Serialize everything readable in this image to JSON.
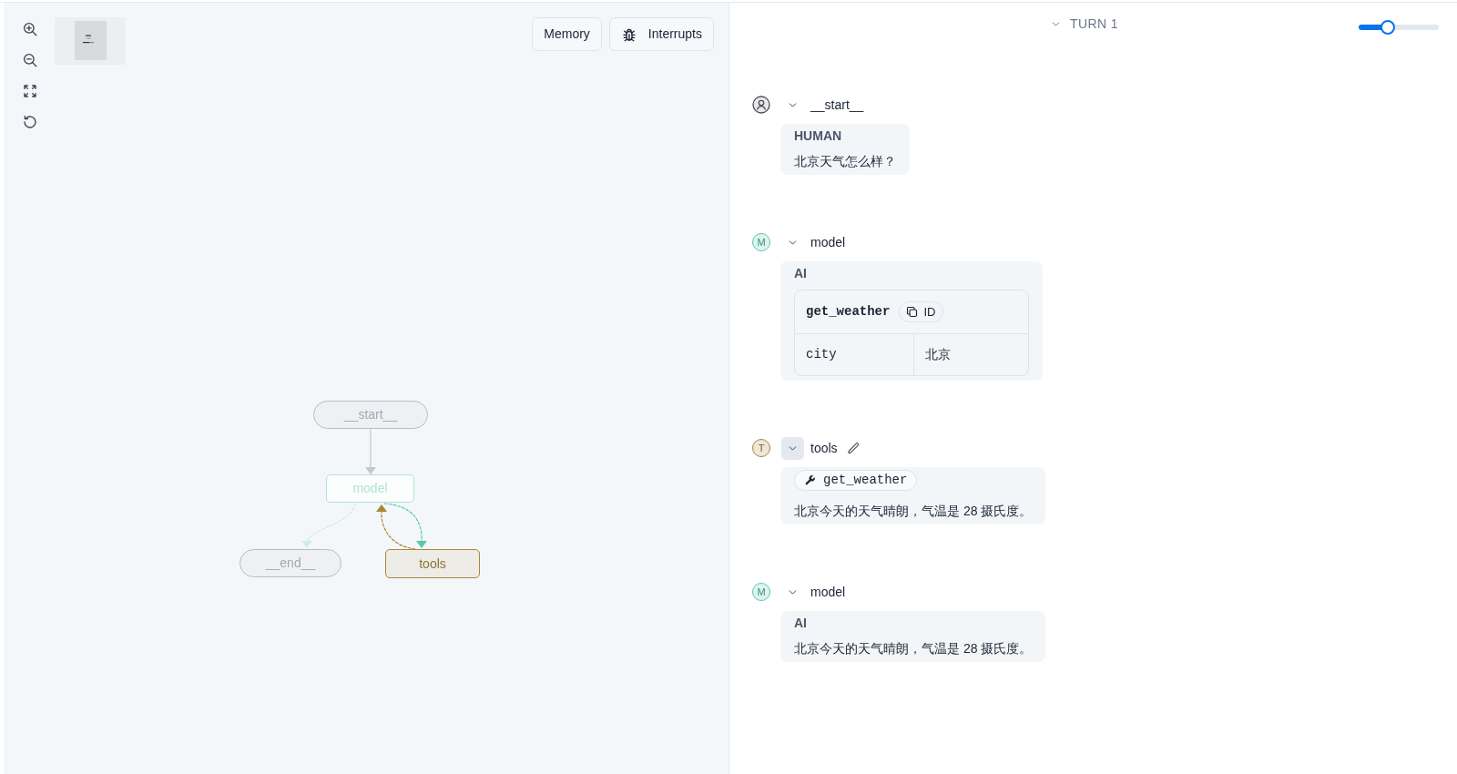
{
  "canvas": {
    "buttons": [
      {
        "label": "Memory",
        "kind": "text"
      },
      {
        "label": "Interrupts",
        "kind": "icon_text"
      }
    ],
    "graph": {
      "nodes": [
        {
          "label": "__start__",
          "kind": "terminal",
          "active": false
        },
        {
          "label": "model",
          "kind": "node",
          "color": "#b0e3d7",
          "active": false
        },
        {
          "label": "__end__",
          "kind": "terminal",
          "active": false
        },
        {
          "label": "tools",
          "kind": "node",
          "color": "#ab853a",
          "active": true
        }
      ]
    }
  },
  "run": {
    "turn": {
      "label": "TURN 1",
      "expanded": true
    },
    "slider": {
      "level": 0.36
    },
    "steps": [
      {
        "node": "__start__",
        "expanded": true,
        "hovered": false,
        "editable": false,
        "avatar": {
          "kind": "person"
        },
        "kind": "message",
        "role": "HUMAN",
        "text": "北京天气怎么样？"
      },
      {
        "node": "model",
        "expanded": true,
        "hovered": false,
        "editable": false,
        "avatar": {
          "kind": "letter",
          "letter": "M",
          "color": "#5cc7b0"
        },
        "kind": "tool_call",
        "role": "AI",
        "tool_call": {
          "name": "get_weather",
          "id_label": "ID",
          "args": [
            {
              "key": "city",
              "value": "北京"
            }
          ]
        }
      },
      {
        "node": "tools",
        "expanded": true,
        "hovered": true,
        "editable": true,
        "avatar": {
          "kind": "letter",
          "letter": "T",
          "color": "#ab853a"
        },
        "kind": "tool_result",
        "tool": "get_weather",
        "text": "北京今天的天气晴朗，气温是 28 摄氏度。"
      },
      {
        "node": "model",
        "expanded": true,
        "hovered": false,
        "editable": false,
        "avatar": {
          "kind": "letter",
          "letter": "M",
          "color": "#5cc7b0"
        },
        "kind": "message",
        "role": "AI",
        "text": "北京今天的天气晴朗，气温是 28 摄氏度。"
      }
    ]
  }
}
